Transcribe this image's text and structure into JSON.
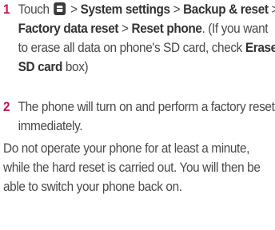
{
  "steps": [
    {
      "number": "1",
      "touch": "Touch",
      "icon": "menu-icon",
      "sep1": ">",
      "system_settings": "System settings",
      "sep2": ">",
      "backup_reset": "Backup & reset",
      "sep3": ">",
      "factory_data_reset": "Factory data reset",
      "sep4": ">",
      "reset_phone": "Reset phone",
      "note_start": ". (If you want to erase all data on phone's SD card, check",
      "erase_sd_card": "Erase SD card",
      "note_end": "box)"
    },
    {
      "number": "2",
      "text": "The phone will turn on and perform a factory reset immediately."
    }
  ],
  "paragraph": "Do not operate your phone for at least a minute, while the hard reset is carried out. You will then be able to switch your phone back on.",
  "colors": {
    "step_number": "#c2185b",
    "body_text": "#4a4a4a"
  }
}
